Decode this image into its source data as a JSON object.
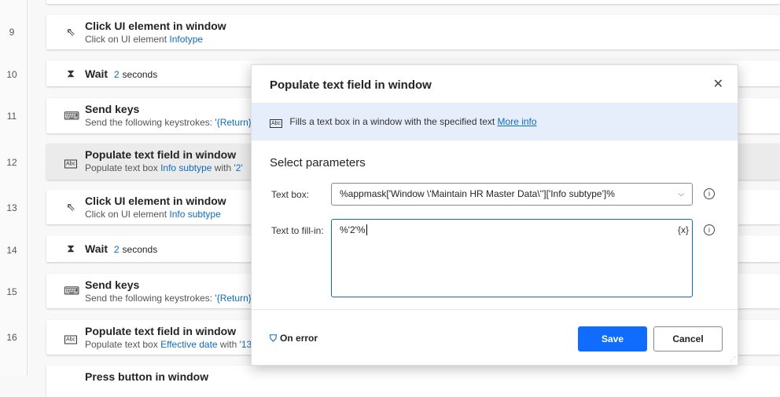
{
  "steps": [
    {
      "num": "9",
      "title": "Click UI element in window",
      "sub_prefix": "Click on UI element ",
      "sub_link": "Infotype",
      "sub_mid": "",
      "sub_value": ""
    },
    {
      "num": "10",
      "title": "Wait",
      "value": "2",
      "suffix": "seconds"
    },
    {
      "num": "11",
      "title": "Send keys",
      "sub_prefix": "Send the following keystrokes: ",
      "sub_link": "'{Return}'"
    },
    {
      "num": "12",
      "title": "Populate text field in window",
      "sub_prefix": "Populate text box ",
      "sub_link": "Info subtype",
      "sub_mid": " with ",
      "sub_value": "'2'"
    },
    {
      "num": "13",
      "title": "Click UI element in window",
      "sub_prefix": "Click on UI element ",
      "sub_link": "Info subtype"
    },
    {
      "num": "14",
      "title": "Wait",
      "value": "2",
      "suffix": "seconds"
    },
    {
      "num": "15",
      "title": "Send keys",
      "sub_prefix": "Send the following keystrokes: ",
      "sub_link": "'{Return}'"
    },
    {
      "num": "16",
      "title": "Populate text field in window",
      "sub_prefix": "Populate text box ",
      "sub_link": "Effective date",
      "sub_mid": " with ",
      "sub_value": "'13"
    },
    {
      "title": "Press button in window"
    }
  ],
  "dialog": {
    "title": "Populate text field in window",
    "description": "Fills a text box in a window with the specified text",
    "more_info": "More info",
    "section": "Select parameters",
    "textbox_label": "Text box:",
    "textbox_value": "%appmask['Window \\'Maintain HR Master Data\\'']['Info subtype']%",
    "fill_label": "Text to fill-in:",
    "fill_value": "%'2'%",
    "var_button": "{x}",
    "on_error": "On error",
    "save": "Save",
    "cancel": "Cancel"
  },
  "colors": {
    "accent": "#0f6cbd",
    "save_bg": "#0f6cfd"
  }
}
